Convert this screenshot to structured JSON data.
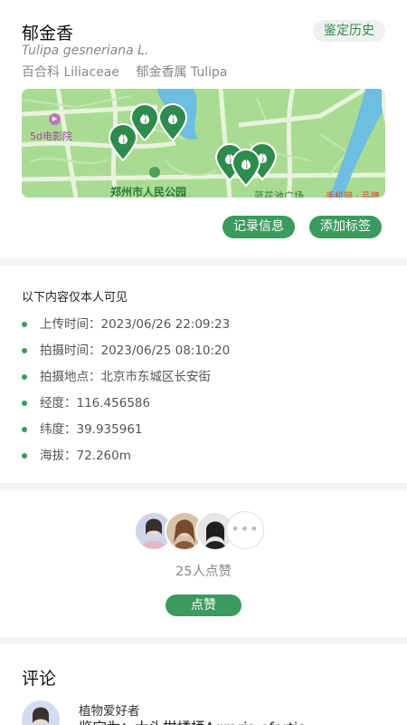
{
  "plant": {
    "name": "郁金香",
    "latin": "Tulipa gesneriana L.",
    "family": "百合科 Liliaceae",
    "genus": "郁金香属 Tulipa"
  },
  "header": {
    "history_label": "鉴定历史"
  },
  "map": {
    "labels": {
      "cinema": "5d电影院",
      "park": "郑州市人民公园",
      "bottom_road": "蓝花池广场",
      "bottom_right": "手机网 · 品牌"
    }
  },
  "actions": {
    "record_label": "记录信息",
    "tag_label": "添加标签"
  },
  "private_info": {
    "title": "以下内容仅本人可见",
    "items": [
      "上传时间：2023/06/26 22:09:23",
      "拍摄时间：2023/06/25 08:10:20",
      "拍摄地点：北京市东城区长安街",
      "经度：116.456586",
      "纬度：39.935961",
      "海拔：72.260m"
    ]
  },
  "likes": {
    "count_text": "25人点赞",
    "like_label": "点赞",
    "more_glyph": "•••"
  },
  "comments": {
    "title": "评论",
    "first": {
      "user": "植物爱好者",
      "text": "鉴定为：大头柑橘栖Agraria efortis"
    }
  },
  "colors": {
    "accent": "#3c9a5f",
    "map_green": "#a9dc92",
    "water": "#6fbde0"
  }
}
